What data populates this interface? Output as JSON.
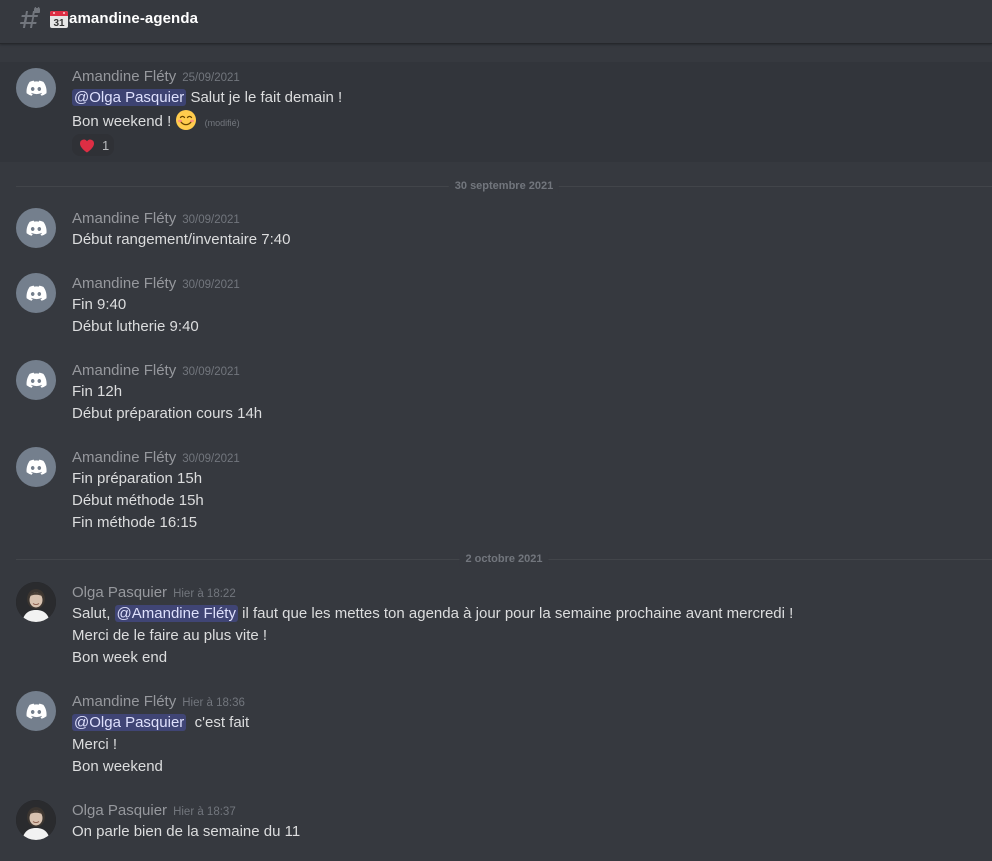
{
  "channel": {
    "name": "amandine-agenda",
    "icon": "calendar-icon",
    "calendar_day": "31"
  },
  "colors": {
    "background": "#36393f",
    "mention_bg": "#5865f24d",
    "author": "#96989d",
    "text": "#dcddde",
    "heart": "#dd2e44"
  },
  "messages": [
    {
      "author": "Amandine Fléty",
      "time": "25/09/2021",
      "mention": "@Olga Pasquier",
      "text1": " Salut je le fait demain !",
      "text2": "Bon weekend !",
      "emoji": "smiling-face-with-smiling-eyes",
      "edited": "(modifié)",
      "reaction_emoji": "heart",
      "reaction_count": "1"
    },
    {
      "author": "Amandine Fléty",
      "time": "30/09/2021",
      "lines": [
        "Début rangement/inventaire 7:40"
      ]
    },
    {
      "author": "Amandine Fléty",
      "time": "30/09/2021",
      "lines": [
        "Fin 9:40",
        "Début lutherie 9:40"
      ]
    },
    {
      "author": "Amandine Fléty",
      "time": "30/09/2021",
      "lines": [
        "Fin 12h",
        "Début préparation cours 14h"
      ]
    },
    {
      "author": "Amandine Fléty",
      "time": "30/09/2021",
      "lines": [
        "Fin préparation 15h",
        "Début méthode 15h",
        "Fin méthode 16:15"
      ]
    },
    {
      "author": "Olga Pasquier",
      "time": "Hier à 18:22",
      "prefix": "Salut, ",
      "mention": "@Amandine Fléty",
      "suffix": " il faut que les mettes ton agenda à jour pour la semaine prochaine avant mercredi !",
      "lines": [
        "Merci de le faire au plus vite !",
        "Bon week end"
      ]
    },
    {
      "author": "Amandine Fléty",
      "time": "Hier à 18:36",
      "mention": "@Olga Pasquier",
      "suffix": "  c'est fait",
      "lines": [
        "Merci !",
        "Bon weekend"
      ]
    },
    {
      "author": "Olga Pasquier",
      "time": "Hier à 18:37",
      "lines": [
        "On parle bien de la semaine du 11"
      ]
    }
  ],
  "dividers": [
    "30 septembre 2021",
    "2 octobre 2021"
  ]
}
